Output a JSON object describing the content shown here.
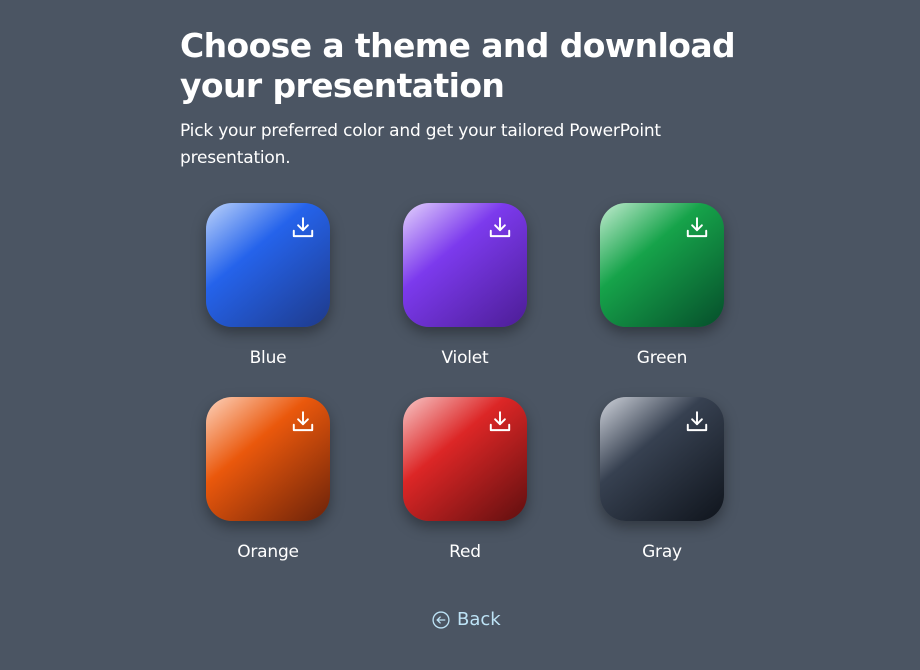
{
  "header": {
    "title": "Choose a theme and download your presentation",
    "subtitle": "Pick your preferred color and get your tailored PowerPoint presentation."
  },
  "themes": [
    {
      "label": "Blue",
      "icon": "download-icon",
      "colors": [
        "#bcd3fb",
        "#2563eb",
        "#1e3a8a"
      ]
    },
    {
      "label": "Violet",
      "icon": "download-icon",
      "colors": [
        "#e3d2fd",
        "#7c3aed",
        "#4c1d95"
      ]
    },
    {
      "label": "Green",
      "icon": "download-icon",
      "colors": [
        "#c2ecd0",
        "#16a34a",
        "#064e2b"
      ]
    },
    {
      "label": "Orange",
      "icon": "download-icon",
      "colors": [
        "#fdd3bd",
        "#ea580c",
        "#6b2209"
      ]
    },
    {
      "label": "Red",
      "icon": "download-icon",
      "colors": [
        "#f8c7c7",
        "#dc2626",
        "#5f0f0f"
      ]
    },
    {
      "label": "Gray",
      "icon": "download-icon",
      "colors": [
        "#cfd3db",
        "#374151",
        "#0f141c"
      ]
    }
  ],
  "back": {
    "label": "Back",
    "icon": "arrow-left-circle-icon",
    "color": "#bde3f6"
  }
}
